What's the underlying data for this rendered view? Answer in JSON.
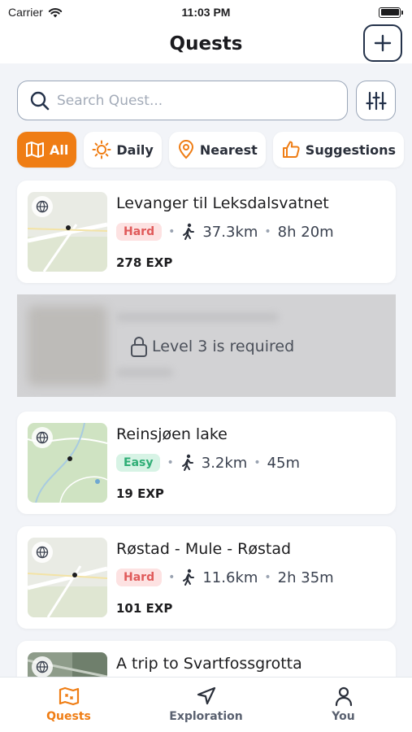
{
  "status_bar": {
    "carrier": "Carrier",
    "time": "11:03 PM"
  },
  "header": {
    "title": "Quests"
  },
  "search": {
    "placeholder": "Search Quest..."
  },
  "filters": [
    {
      "label": "All",
      "icon": "map-icon",
      "active": true
    },
    {
      "label": "Daily",
      "icon": "sun-icon",
      "active": false
    },
    {
      "label": "Nearest",
      "icon": "location-pin-icon",
      "active": false
    },
    {
      "label": "Suggestions",
      "icon": "thumbs-up-icon",
      "active": false
    }
  ],
  "quests": [
    {
      "title": "Levanger til Leksdalsvatnet",
      "difficulty": "Hard",
      "distance": "37.3km",
      "duration": "8h 20m",
      "exp": "278 EXP"
    },
    {
      "locked": true,
      "lock_message": "Level 3 is required"
    },
    {
      "title": "Reinsjøen lake",
      "difficulty": "Easy",
      "distance": "3.2km",
      "duration": "45m",
      "exp": "19 EXP"
    },
    {
      "title": "Røstad - Mule - Røstad",
      "difficulty": "Hard",
      "distance": "11.6km",
      "duration": "2h 35m",
      "exp": "101 EXP"
    },
    {
      "title": "A trip to Svartfossgrotta"
    }
  ],
  "tabs": [
    {
      "label": "Quests",
      "icon": "quests-map-icon",
      "active": true
    },
    {
      "label": "Exploration",
      "icon": "navigation-arrow-icon",
      "active": false
    },
    {
      "label": "You",
      "icon": "person-icon",
      "active": false
    }
  ],
  "colors": {
    "accent": "#ef7d14",
    "hard": "#e05a5a",
    "easy": "#2fae76"
  }
}
